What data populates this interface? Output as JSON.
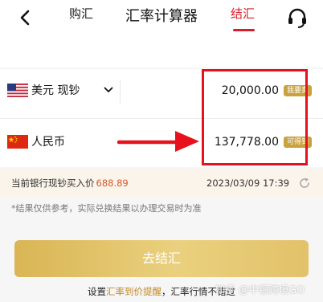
{
  "header": {
    "title": "汇率计算器",
    "back_icon": "chevron-left-icon",
    "support_icon": "headset-icon"
  },
  "tabs": [
    {
      "label": "购汇",
      "active": false
    },
    {
      "label": "结汇",
      "active": true
    }
  ],
  "converter": {
    "from": {
      "flag": "us-flag-icon",
      "label": "美元 现钞",
      "amount": "20,000.00",
      "tag": "我要卖"
    },
    "to": {
      "flag": "cn-flag-icon",
      "label": "人民币",
      "amount": "137,778.00",
      "tag": "可得到"
    }
  },
  "rate": {
    "label": "当前银行现钞买入价",
    "value": "688.89",
    "timestamp": "2023/03/09 17:39"
  },
  "disclaimer": "*结果仅供参考，实际兑换结果以办理交易时为准",
  "action": {
    "label": "去结汇"
  },
  "footer": {
    "prefix": "设置",
    "link": "汇率到价提醒",
    "suffix": "，汇率行情不错过"
  },
  "watermark": "知乎 @中银跨境GO",
  "colors": {
    "accent_red": "#d81e2a",
    "gold": "#c9a23f",
    "rate_orange": "#d35a2a",
    "annotation_red": "#e8101a"
  }
}
